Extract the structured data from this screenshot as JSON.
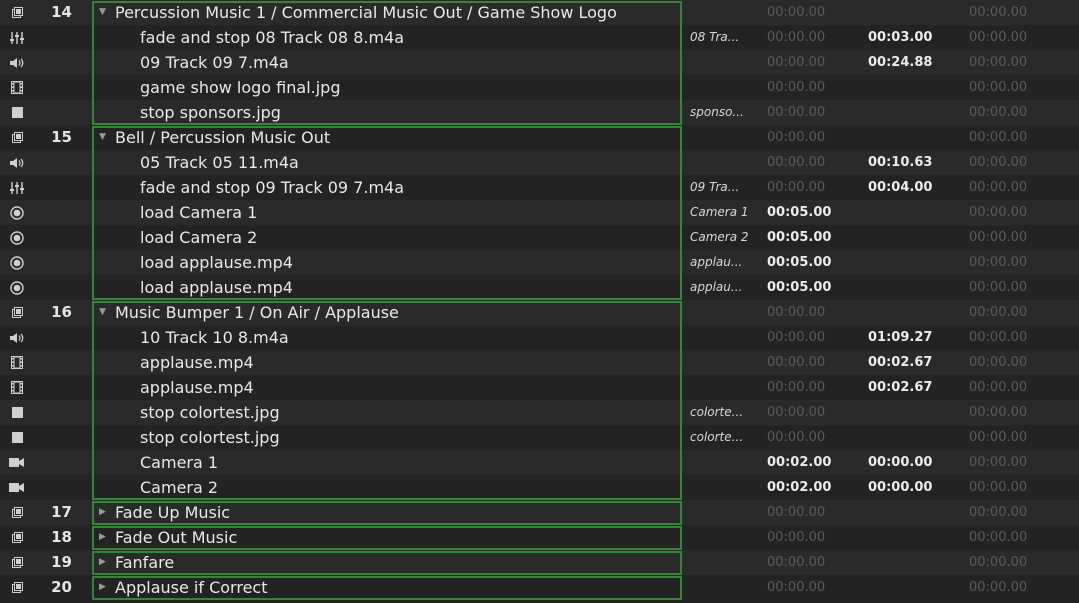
{
  "cues": [
    {
      "type": "group",
      "number": "14",
      "name": "Percussion Music 1 / Commercial Music Out / Game Show Logo",
      "target": "",
      "pre_wait": "00:00.00",
      "action": "",
      "post_wait": "00:00.00"
    },
    {
      "type": "fade",
      "number": "",
      "name": "fade and stop 08 Track 08 8.m4a",
      "target": "08 Tra...",
      "pre_wait": "00:00.00",
      "action": "00:03.00",
      "post_wait": "00:00.00"
    },
    {
      "type": "audio",
      "number": "",
      "name": "09 Track 09 7.m4a",
      "target": "",
      "pre_wait": "00:00.00",
      "action": "00:24.88",
      "post_wait": "00:00.00"
    },
    {
      "type": "video",
      "number": "",
      "name": "game show logo final.jpg",
      "target": "",
      "pre_wait": "00:00.00",
      "action": "",
      "post_wait": "00:00.00"
    },
    {
      "type": "stop",
      "number": "",
      "name": "stop sponsors.jpg",
      "target": "sponso...",
      "pre_wait": "00:00.00",
      "action": "",
      "post_wait": "00:00.00"
    },
    {
      "type": "group",
      "number": "15",
      "name": "Bell / Percussion Music Out",
      "target": "",
      "pre_wait": "00:00.00",
      "action": "",
      "post_wait": "00:00.00"
    },
    {
      "type": "audio",
      "number": "",
      "name": "05 Track 05 11.m4a",
      "target": "",
      "pre_wait": "00:00.00",
      "action": "00:10.63",
      "post_wait": "00:00.00"
    },
    {
      "type": "fade",
      "number": "",
      "name": "fade and stop 09 Track 09 7.m4a",
      "target": "09 Tra...",
      "pre_wait": "00:00.00",
      "action": "00:04.00",
      "post_wait": "00:00.00"
    },
    {
      "type": "load",
      "number": "",
      "name": "load Camera 1",
      "target": "Camera 1",
      "pre_wait": "00:05.00",
      "action": "",
      "post_wait": "00:00.00"
    },
    {
      "type": "load",
      "number": "",
      "name": "load Camera 2",
      "target": "Camera 2",
      "pre_wait": "00:05.00",
      "action": "",
      "post_wait": "00:00.00"
    },
    {
      "type": "load",
      "number": "",
      "name": "load applause.mp4",
      "target": "applau...",
      "pre_wait": "00:05.00",
      "action": "",
      "post_wait": "00:00.00"
    },
    {
      "type": "load",
      "number": "",
      "name": "load applause.mp4",
      "target": "applau...",
      "pre_wait": "00:05.00",
      "action": "",
      "post_wait": "00:00.00"
    },
    {
      "type": "group",
      "number": "16",
      "name": "Music Bumper 1 / On Air / Applause",
      "target": "",
      "pre_wait": "00:00.00",
      "action": "",
      "post_wait": "00:00.00"
    },
    {
      "type": "audio",
      "number": "",
      "name": "10 Track 10 8.m4a",
      "target": "",
      "pre_wait": "00:00.00",
      "action": "01:09.27",
      "post_wait": "00:00.00"
    },
    {
      "type": "video",
      "number": "",
      "name": "applause.mp4",
      "target": "",
      "pre_wait": "00:00.00",
      "action": "00:02.67",
      "post_wait": "00:00.00"
    },
    {
      "type": "video",
      "number": "",
      "name": "applause.mp4",
      "target": "",
      "pre_wait": "00:00.00",
      "action": "00:02.67",
      "post_wait": "00:00.00"
    },
    {
      "type": "stop",
      "number": "",
      "name": "stop colortest.jpg",
      "target": "colorte...",
      "pre_wait": "00:00.00",
      "action": "",
      "post_wait": "00:00.00"
    },
    {
      "type": "stop",
      "number": "",
      "name": "stop colortest.jpg",
      "target": "colorte...",
      "pre_wait": "00:00.00",
      "action": "",
      "post_wait": "00:00.00"
    },
    {
      "type": "camera",
      "number": "",
      "name": "Camera 1",
      "target": "",
      "pre_wait": "00:02.00",
      "action": "00:00.00",
      "post_wait": "00:00.00"
    },
    {
      "type": "camera",
      "number": "",
      "name": "Camera 2",
      "target": "",
      "pre_wait": "00:02.00",
      "action": "00:00.00",
      "post_wait": "00:00.00"
    },
    {
      "type": "group",
      "number": "17",
      "name": "Fade Up Music",
      "target": "",
      "pre_wait": "00:00.00",
      "action": "",
      "post_wait": "00:00.00",
      "collapsed": true
    },
    {
      "type": "group",
      "number": "18",
      "name": "Fade Out Music",
      "target": "",
      "pre_wait": "00:00.00",
      "action": "",
      "post_wait": "00:00.00",
      "collapsed": true
    },
    {
      "type": "group",
      "number": "19",
      "name": "Fanfare",
      "target": "",
      "pre_wait": "00:00.00",
      "action": "",
      "post_wait": "00:00.00",
      "collapsed": true
    },
    {
      "type": "group",
      "number": "20",
      "name": "Applause if Correct",
      "target": "",
      "pre_wait": "00:00.00",
      "action": "",
      "post_wait": "00:00.00",
      "collapsed": true
    }
  ],
  "active_times": {
    "pre_wait": [
      "00:05.00",
      "00:02.00"
    ],
    "action": [
      "00:03.00",
      "00:24.88",
      "00:10.63",
      "00:04.00",
      "01:09.27",
      "00:02.67",
      "00:00.00"
    ]
  },
  "colors": {
    "group_border": "#2f8a2f",
    "bg_dark": "#232323",
    "bg_light": "#2a2a2a",
    "dim_text": "#5b5b5b",
    "text": "#e9e9e9"
  }
}
